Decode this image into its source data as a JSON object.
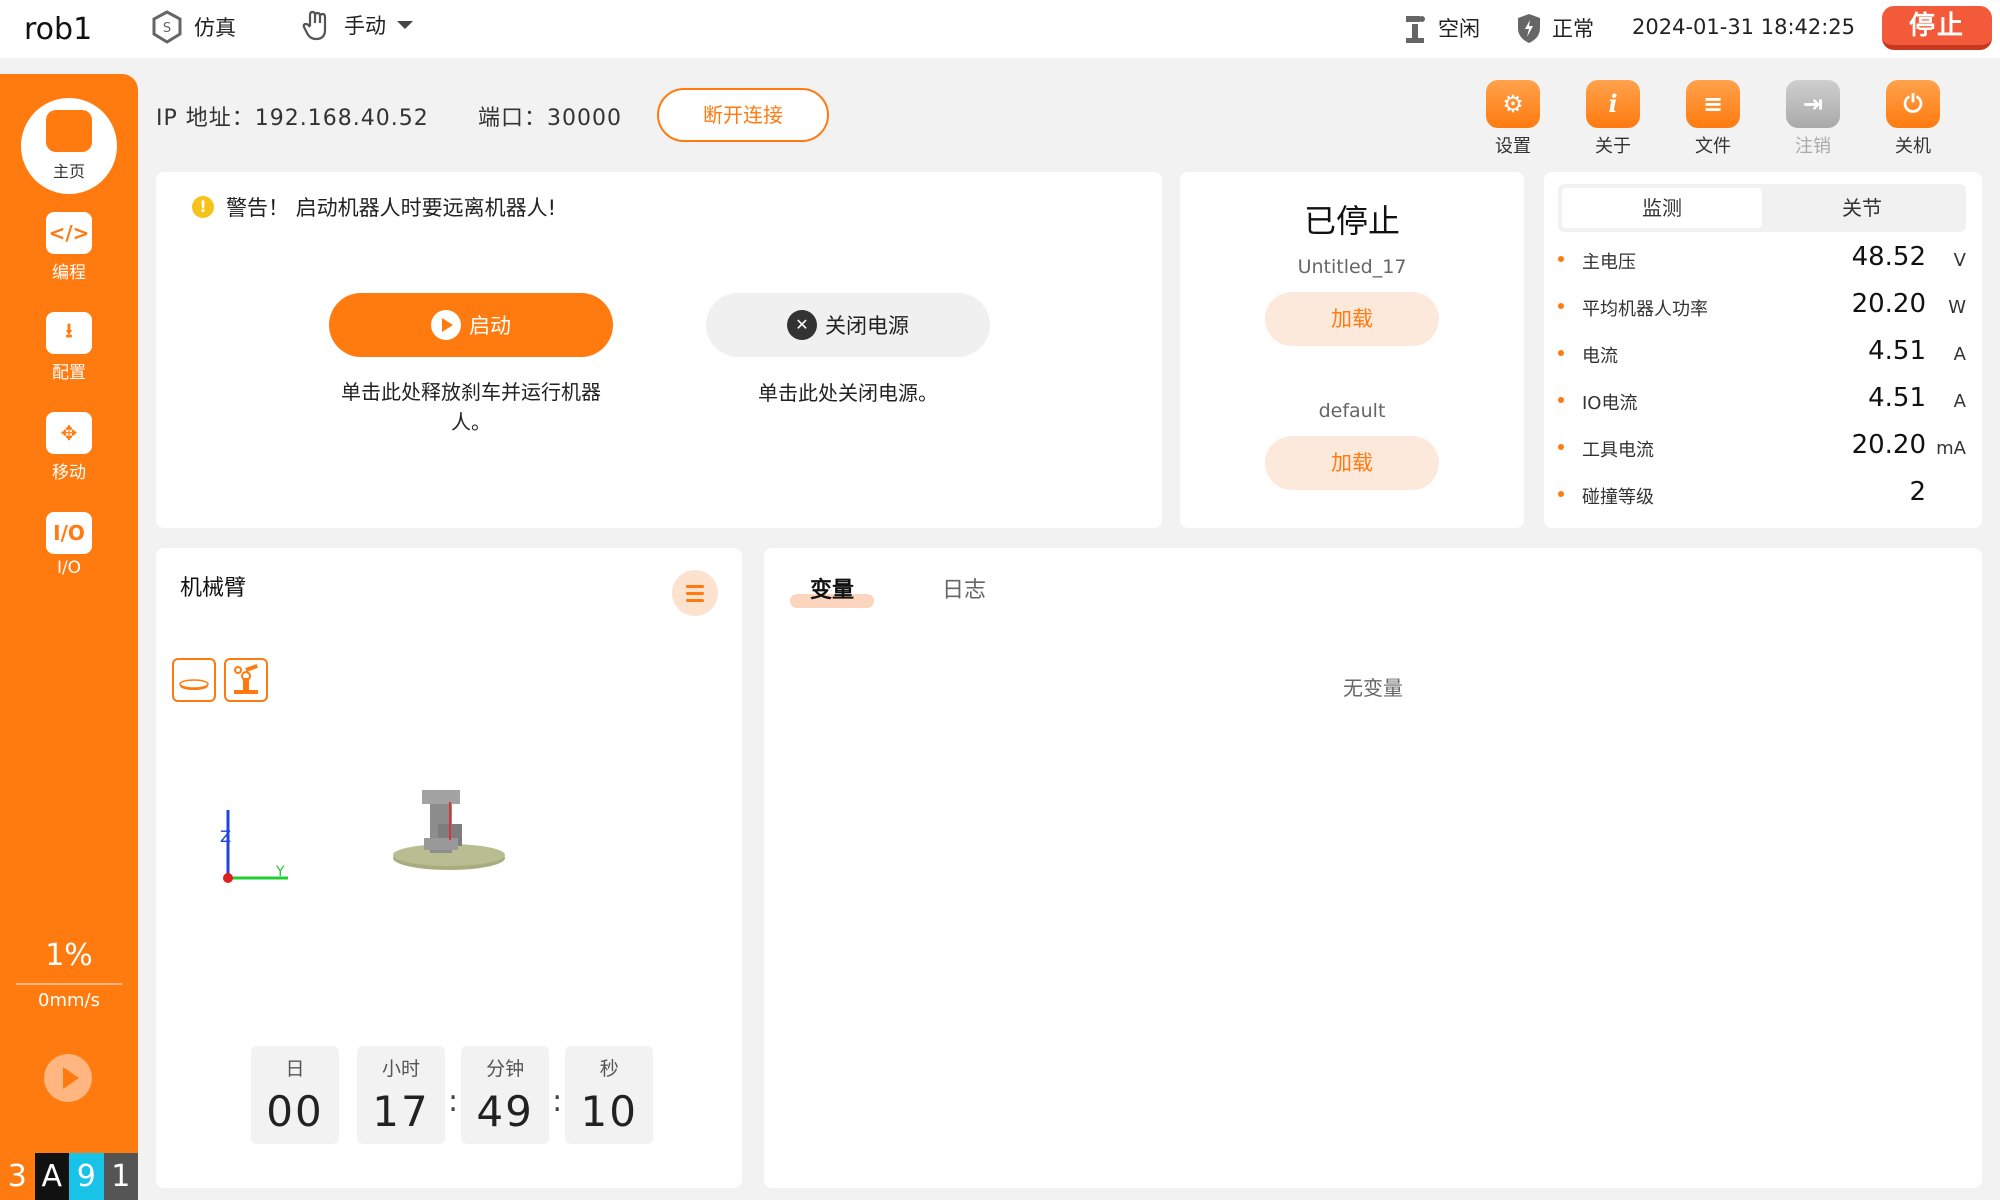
{
  "topbar": {
    "robot_name": "rob1",
    "mode": "仿真",
    "control_mode": "手动",
    "robot_state": "空闲",
    "safety_state": "正常",
    "datetime": "2024-01-31 18:42:25",
    "stop_label": "停止"
  },
  "sidebar": {
    "items": [
      {
        "label": "主页",
        "icon": "home-icon"
      },
      {
        "label": "编程",
        "icon": "code-icon"
      },
      {
        "label": "配置",
        "icon": "download-book-icon"
      },
      {
        "label": "移动",
        "icon": "move-arrows-icon"
      },
      {
        "label": "I/O",
        "icon": "io-icon"
      }
    ],
    "speed_percent": "1%",
    "speed_value": "0mm/s",
    "tags": [
      "3",
      "A",
      "9",
      "1"
    ],
    "tag_colors": [
      "#ff7a0f",
      "#111111",
      "#18c3e8",
      "#555555"
    ]
  },
  "connection": {
    "ip_label": "IP 地址：",
    "ip_value": "192.168.40.52",
    "port_label": "端口：",
    "port_value": "30000",
    "disconnect_label": "断开连接"
  },
  "toolbar": {
    "items": [
      {
        "label": "设置",
        "icon": "settings-icon",
        "glyph": "⚙"
      },
      {
        "label": "关于",
        "icon": "info-icon",
        "glyph": "i"
      },
      {
        "label": "文件",
        "icon": "file-icon",
        "glyph": "≡"
      },
      {
        "label": "注销",
        "icon": "logout-icon",
        "glyph": "⇥"
      },
      {
        "label": "关机",
        "icon": "power-icon",
        "glyph": "⏻"
      }
    ]
  },
  "start_panel": {
    "warning": "警告！ 启动机器人时要远离机器人!",
    "start_label": "启动",
    "start_desc": "单击此处释放刹车并运行机器人。",
    "power_label": "关闭电源",
    "power_desc": "单击此处关闭电源。"
  },
  "program_panel": {
    "state": "已停止",
    "program_name": "Untitled_17",
    "load_label_1": "加载",
    "default_name": "default",
    "load_label_2": "加载"
  },
  "monitor_panel": {
    "tabs": [
      "监测",
      "关节"
    ],
    "rows": [
      {
        "label": "主电压",
        "value": "48.52",
        "unit": "V"
      },
      {
        "label": "平均机器人功率",
        "value": "20.20",
        "unit": "W"
      },
      {
        "label": "电流",
        "value": "4.51",
        "unit": "A"
      },
      {
        "label": "IO电流",
        "value": "4.51",
        "unit": "A"
      },
      {
        "label": "工具电流",
        "value": "20.20",
        "unit": "mA"
      },
      {
        "label": "碰撞等级",
        "value": "2",
        "unit": ""
      }
    ]
  },
  "arm_panel": {
    "title": "机械臂",
    "axis_z": "Z",
    "axis_y": "Y",
    "timer": {
      "days_label": "日",
      "days": "00",
      "hours_label": "小时",
      "hours": "17",
      "minutes_label": "分钟",
      "minutes": "49",
      "seconds_label": "秒",
      "seconds": "10",
      "sep": ":"
    }
  },
  "vars_panel": {
    "tabs": [
      "变量",
      "日志"
    ],
    "empty_text": "无变量"
  },
  "colors": {
    "accent": "#ff7a0f",
    "stop": "#f25a3a",
    "warning": "#f7c31a"
  }
}
